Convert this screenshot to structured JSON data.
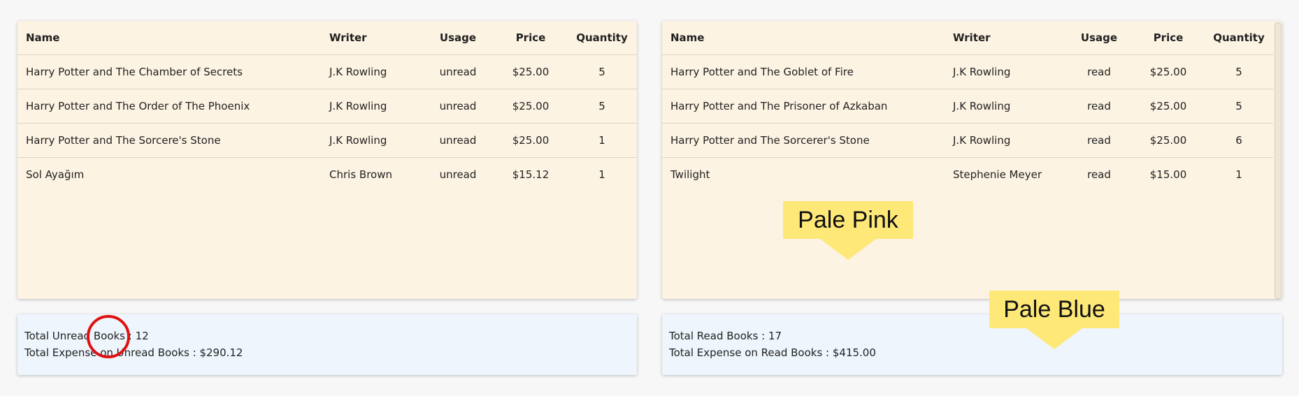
{
  "unread_table": {
    "headers": [
      "Name",
      "Writer",
      "Usage",
      "Price",
      "Quantity"
    ],
    "rows": [
      [
        "Harry Potter and The Chamber of Secrets",
        "J.K Rowling",
        "unread",
        "$25.00",
        "5"
      ],
      [
        "Harry Potter and The Order of The Phoenix",
        "J.K Rowling",
        "unread",
        "$25.00",
        "5"
      ],
      [
        "Harry Potter and The Sorcere's Stone",
        "J.K Rowling",
        "unread",
        "$25.00",
        "1"
      ],
      [
        "Sol Ayağım",
        "Chris Brown",
        "unread",
        "$15.12",
        "1"
      ]
    ]
  },
  "read_table": {
    "headers": [
      "Name",
      "Writer",
      "Usage",
      "Price",
      "Quantity"
    ],
    "rows": [
      [
        "Harry Potter and The Goblet of Fire",
        "J.K Rowling",
        "read",
        "$25.00",
        "5"
      ],
      [
        "Harry Potter and The Prisoner of Azkaban",
        "J.K Rowling",
        "read",
        "$25.00",
        "5"
      ],
      [
        "Harry Potter and The Sorcerer's Stone",
        "J.K Rowling",
        "read",
        "$25.00",
        "6"
      ],
      [
        "Twilight",
        "Stephenie Meyer",
        "read",
        "$15.00",
        "1"
      ]
    ]
  },
  "unread_summary": {
    "total_books": "Total Unread Books : 12",
    "total_expense": "Total Expense on Unread Books : $290.12"
  },
  "read_summary": {
    "total_books": "Total Read Books : 17",
    "total_expense": "Total Expense on Read Books : $415.00"
  },
  "callouts": {
    "pink": "Pale Pink",
    "blue": "Pale Blue"
  },
  "colors": {
    "table_background": "#fdf3e3",
    "summary_background": "#eef5fd",
    "callout": "#fde878",
    "highlight_circle": "#e01010"
  }
}
